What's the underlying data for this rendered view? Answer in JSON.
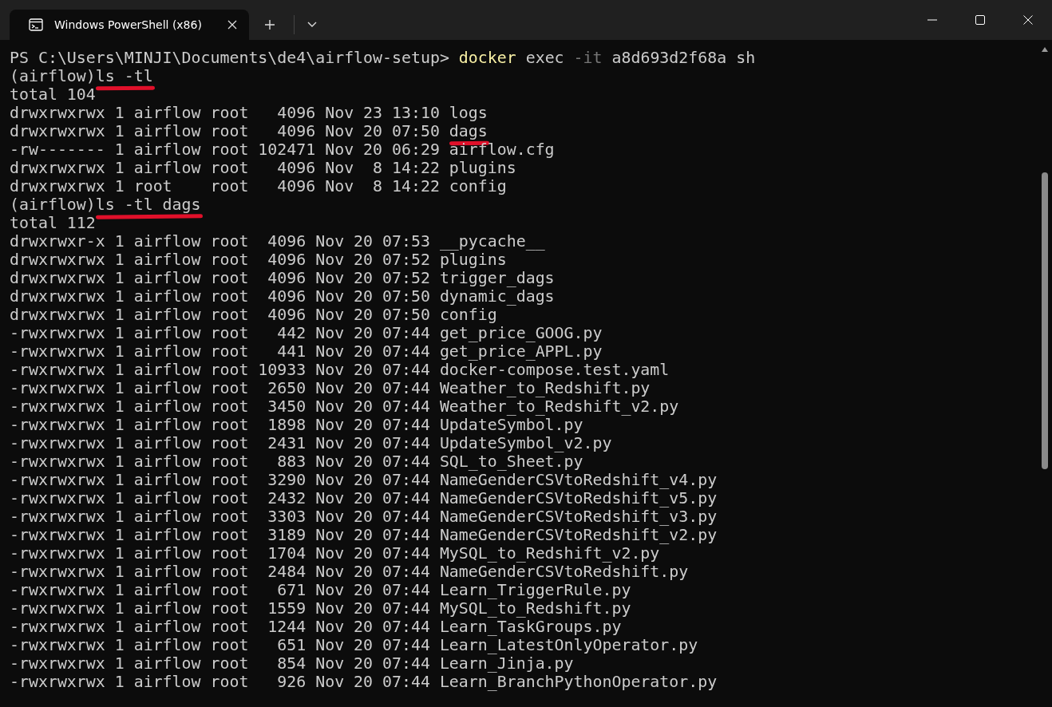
{
  "window": {
    "tab": {
      "title": "Windows PowerShell (x86)",
      "selected": true
    }
  },
  "terminal": {
    "lines": [
      {
        "segments": [
          {
            "text": "PS C:\\Users\\MINJI\\Documents\\de4\\airflow-setup> ",
            "color": "#cccccc",
            "marked": false
          },
          {
            "text": "docker",
            "color": "#f9f1a5",
            "marked": false
          },
          {
            "text": " exec ",
            "color": "#cccccc",
            "marked": false
          },
          {
            "text": "-it",
            "color": "#767676",
            "marked": false
          },
          {
            "text": " a8d693d2f68a sh",
            "color": "#cccccc",
            "marked": false
          }
        ]
      },
      {
        "segments": [
          {
            "text": "(airflow)",
            "color": "#cccccc",
            "marked": false
          },
          {
            "text": "ls -tl",
            "color": "#cccccc",
            "marked": true
          }
        ]
      },
      {
        "segments": [
          {
            "text": "total 104",
            "color": "#cccccc",
            "marked": false
          }
        ]
      },
      {
        "segments": [
          {
            "text": "drwxrwxrwx 1 airflow root   4096 Nov 23 13:10 logs",
            "color": "#cccccc",
            "marked": false
          }
        ]
      },
      {
        "segments": [
          {
            "text": "drwxrwxrwx 1 airflow root   4096 Nov 20 07:50 ",
            "color": "#cccccc",
            "marked": false
          },
          {
            "text": "dags",
            "color": "#cccccc",
            "marked": true
          }
        ]
      },
      {
        "segments": [
          {
            "text": "-rw------- 1 airflow root 102471 Nov 20 06:29 airflow.cfg",
            "color": "#cccccc",
            "marked": false
          }
        ]
      },
      {
        "segments": [
          {
            "text": "drwxrwxrwx 1 airflow root   4096 Nov  8 14:22 plugins",
            "color": "#cccccc",
            "marked": false
          }
        ]
      },
      {
        "segments": [
          {
            "text": "drwxrwxrwx 1 root    root   4096 Nov  8 14:22 config",
            "color": "#cccccc",
            "marked": false
          }
        ]
      },
      {
        "segments": [
          {
            "text": "(airflow)",
            "color": "#cccccc",
            "marked": false
          },
          {
            "text": "ls -tl dags",
            "color": "#cccccc",
            "marked": true
          }
        ]
      },
      {
        "segments": [
          {
            "text": "total 112",
            "color": "#cccccc",
            "marked": false
          }
        ]
      },
      {
        "segments": [
          {
            "text": "drwxrwxr-x 1 airflow root  4096 Nov 20 07:53 __pycache__",
            "color": "#cccccc",
            "marked": false
          }
        ]
      },
      {
        "segments": [
          {
            "text": "drwxrwxrwx 1 airflow root  4096 Nov 20 07:52 plugins",
            "color": "#cccccc",
            "marked": false
          }
        ]
      },
      {
        "segments": [
          {
            "text": "drwxrwxrwx 1 airflow root  4096 Nov 20 07:52 trigger_dags",
            "color": "#cccccc",
            "marked": false
          }
        ]
      },
      {
        "segments": [
          {
            "text": "drwxrwxrwx 1 airflow root  4096 Nov 20 07:50 dynamic_dags",
            "color": "#cccccc",
            "marked": false
          }
        ]
      },
      {
        "segments": [
          {
            "text": "drwxrwxrwx 1 airflow root  4096 Nov 20 07:50 config",
            "color": "#cccccc",
            "marked": false
          }
        ]
      },
      {
        "segments": [
          {
            "text": "-rwxrwxrwx 1 airflow root   442 Nov 20 07:44 get_price_GOOG.py",
            "color": "#cccccc",
            "marked": false
          }
        ]
      },
      {
        "segments": [
          {
            "text": "-rwxrwxrwx 1 airflow root   441 Nov 20 07:44 get_price_APPL.py",
            "color": "#cccccc",
            "marked": false
          }
        ]
      },
      {
        "segments": [
          {
            "text": "-rwxrwxrwx 1 airflow root 10933 Nov 20 07:44 docker-compose.test.yaml",
            "color": "#cccccc",
            "marked": false
          }
        ]
      },
      {
        "segments": [
          {
            "text": "-rwxrwxrwx 1 airflow root  2650 Nov 20 07:44 Weather_to_Redshift.py",
            "color": "#cccccc",
            "marked": false
          }
        ]
      },
      {
        "segments": [
          {
            "text": "-rwxrwxrwx 1 airflow root  3450 Nov 20 07:44 Weather_to_Redshift_v2.py",
            "color": "#cccccc",
            "marked": false
          }
        ]
      },
      {
        "segments": [
          {
            "text": "-rwxrwxrwx 1 airflow root  1898 Nov 20 07:44 UpdateSymbol.py",
            "color": "#cccccc",
            "marked": false
          }
        ]
      },
      {
        "segments": [
          {
            "text": "-rwxrwxrwx 1 airflow root  2431 Nov 20 07:44 UpdateSymbol_v2.py",
            "color": "#cccccc",
            "marked": false
          }
        ]
      },
      {
        "segments": [
          {
            "text": "-rwxrwxrwx 1 airflow root   883 Nov 20 07:44 SQL_to_Sheet.py",
            "color": "#cccccc",
            "marked": false
          }
        ]
      },
      {
        "segments": [
          {
            "text": "-rwxrwxrwx 1 airflow root  3290 Nov 20 07:44 NameGenderCSVtoRedshift_v4.py",
            "color": "#cccccc",
            "marked": false
          }
        ]
      },
      {
        "segments": [
          {
            "text": "-rwxrwxrwx 1 airflow root  2432 Nov 20 07:44 NameGenderCSVtoRedshift_v5.py",
            "color": "#cccccc",
            "marked": false
          }
        ]
      },
      {
        "segments": [
          {
            "text": "-rwxrwxrwx 1 airflow root  3303 Nov 20 07:44 NameGenderCSVtoRedshift_v3.py",
            "color": "#cccccc",
            "marked": false
          }
        ]
      },
      {
        "segments": [
          {
            "text": "-rwxrwxrwx 1 airflow root  3189 Nov 20 07:44 NameGenderCSVtoRedshift_v2.py",
            "color": "#cccccc",
            "marked": false
          }
        ]
      },
      {
        "segments": [
          {
            "text": "-rwxrwxrwx 1 airflow root  1704 Nov 20 07:44 MySQL_to_Redshift_v2.py",
            "color": "#cccccc",
            "marked": false
          }
        ]
      },
      {
        "segments": [
          {
            "text": "-rwxrwxrwx 1 airflow root  2484 Nov 20 07:44 NameGenderCSVtoRedshift.py",
            "color": "#cccccc",
            "marked": false
          }
        ]
      },
      {
        "segments": [
          {
            "text": "-rwxrwxrwx 1 airflow root   671 Nov 20 07:44 Learn_TriggerRule.py",
            "color": "#cccccc",
            "marked": false
          }
        ]
      },
      {
        "segments": [
          {
            "text": "-rwxrwxrwx 1 airflow root  1559 Nov 20 07:44 MySQL_to_Redshift.py",
            "color": "#cccccc",
            "marked": false
          }
        ]
      },
      {
        "segments": [
          {
            "text": "-rwxrwxrwx 1 airflow root  1244 Nov 20 07:44 Learn_TaskGroups.py",
            "color": "#cccccc",
            "marked": false
          }
        ]
      },
      {
        "segments": [
          {
            "text": "-rwxrwxrwx 1 airflow root   651 Nov 20 07:44 Learn_LatestOnlyOperator.py",
            "color": "#cccccc",
            "marked": false
          }
        ]
      },
      {
        "segments": [
          {
            "text": "-rwxrwxrwx 1 airflow root   854 Nov 20 07:44 Learn_Jinja.py",
            "color": "#cccccc",
            "marked": false
          }
        ]
      },
      {
        "segments": [
          {
            "text": "-rwxrwxrwx 1 airflow root   926 Nov 20 07:44 Learn_BranchPythonOperator.py",
            "color": "#cccccc",
            "marked": false
          }
        ]
      }
    ]
  }
}
